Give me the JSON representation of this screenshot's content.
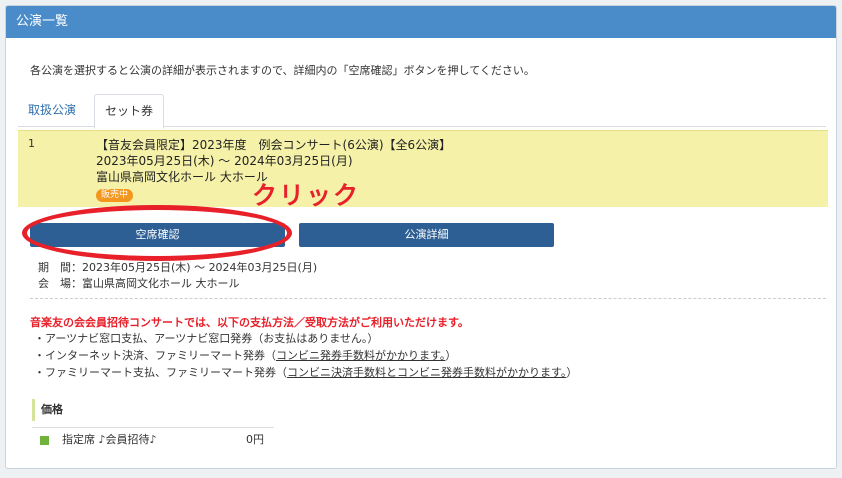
{
  "panel": {
    "title": "公演一覧"
  },
  "intro": "各公演を選択すると公演の詳細が表示されますので、詳細内の「空席確認」ボタンを押してください。",
  "tabs": [
    {
      "label": "取扱公演"
    },
    {
      "label": "セット券"
    }
  ],
  "event": {
    "number": "1",
    "title": "【音友会員限定】2023年度　例会コンサート(6公演)【全6公演】",
    "dates": "2023年05月25日(木) ～ 2024年03月25日(月)",
    "venue": "富山県高岡文化ホール 大ホール",
    "status_badge": "販売中"
  },
  "annotation": {
    "click_label": "クリック",
    "highlight_color": "#e8202a"
  },
  "buttons": {
    "seat_check": "空席確認",
    "details": "公演詳細"
  },
  "info": {
    "period": "期　間：2023年05月25日(木) ～ 2024年03月25日(月)",
    "place": "会　場：富山県高岡文化ホール 大ホール"
  },
  "payment": {
    "heading": "音楽友の会会員招待コンサートでは、以下の支払方法／受取方法がご利用いただけます。",
    "line1": "・アーツナビ窓口支払、アーツナビ窓口発券（お支払はありません。）",
    "line2_prefix": "・インターネット決済、ファミリーマート発券（",
    "line2_link": "コンビニ発券手数料がかかります。",
    "line2_suffix": "）",
    "line3_prefix": "・ファミリーマート支払、ファミリーマート発券（",
    "line3_link": "コンビニ決済手数料とコンビニ発券手数料がかかります。",
    "line3_suffix": "）"
  },
  "price": {
    "heading": "価格",
    "rows": [
      {
        "label": "指定席 ♪会員招待♪",
        "value": "0円"
      }
    ]
  },
  "colors": {
    "header": "#4a8cc9",
    "button": "#2e5f94",
    "event_bg": "#f5f1a8",
    "badge": "#f2961e"
  }
}
